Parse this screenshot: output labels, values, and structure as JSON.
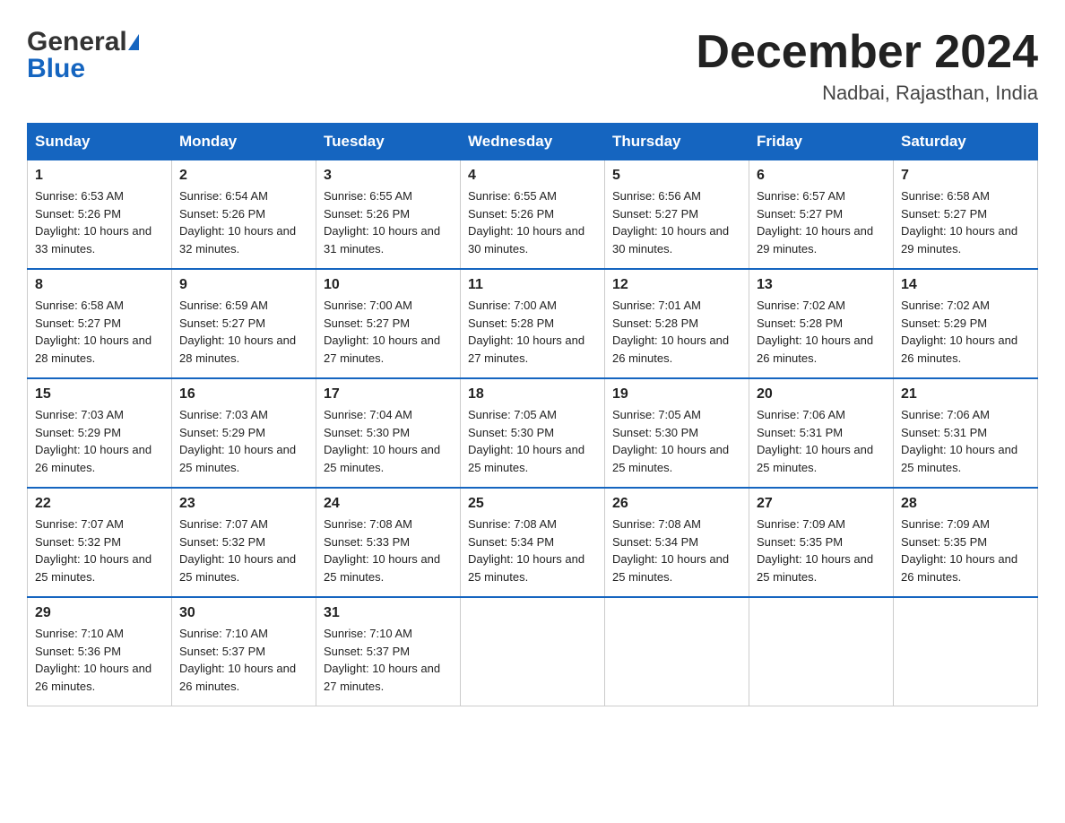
{
  "logo": {
    "general": "General",
    "blue": "Blue",
    "triangle": "▲"
  },
  "title": {
    "month_year": "December 2024",
    "location": "Nadbai, Rajasthan, India"
  },
  "headers": [
    "Sunday",
    "Monday",
    "Tuesday",
    "Wednesday",
    "Thursday",
    "Friday",
    "Saturday"
  ],
  "weeks": [
    [
      {
        "day": "1",
        "sunrise": "Sunrise: 6:53 AM",
        "sunset": "Sunset: 5:26 PM",
        "daylight": "Daylight: 10 hours and 33 minutes."
      },
      {
        "day": "2",
        "sunrise": "Sunrise: 6:54 AM",
        "sunset": "Sunset: 5:26 PM",
        "daylight": "Daylight: 10 hours and 32 minutes."
      },
      {
        "day": "3",
        "sunrise": "Sunrise: 6:55 AM",
        "sunset": "Sunset: 5:26 PM",
        "daylight": "Daylight: 10 hours and 31 minutes."
      },
      {
        "day": "4",
        "sunrise": "Sunrise: 6:55 AM",
        "sunset": "Sunset: 5:26 PM",
        "daylight": "Daylight: 10 hours and 30 minutes."
      },
      {
        "day": "5",
        "sunrise": "Sunrise: 6:56 AM",
        "sunset": "Sunset: 5:27 PM",
        "daylight": "Daylight: 10 hours and 30 minutes."
      },
      {
        "day": "6",
        "sunrise": "Sunrise: 6:57 AM",
        "sunset": "Sunset: 5:27 PM",
        "daylight": "Daylight: 10 hours and 29 minutes."
      },
      {
        "day": "7",
        "sunrise": "Sunrise: 6:58 AM",
        "sunset": "Sunset: 5:27 PM",
        "daylight": "Daylight: 10 hours and 29 minutes."
      }
    ],
    [
      {
        "day": "8",
        "sunrise": "Sunrise: 6:58 AM",
        "sunset": "Sunset: 5:27 PM",
        "daylight": "Daylight: 10 hours and 28 minutes."
      },
      {
        "day": "9",
        "sunrise": "Sunrise: 6:59 AM",
        "sunset": "Sunset: 5:27 PM",
        "daylight": "Daylight: 10 hours and 28 minutes."
      },
      {
        "day": "10",
        "sunrise": "Sunrise: 7:00 AM",
        "sunset": "Sunset: 5:27 PM",
        "daylight": "Daylight: 10 hours and 27 minutes."
      },
      {
        "day": "11",
        "sunrise": "Sunrise: 7:00 AM",
        "sunset": "Sunset: 5:28 PM",
        "daylight": "Daylight: 10 hours and 27 minutes."
      },
      {
        "day": "12",
        "sunrise": "Sunrise: 7:01 AM",
        "sunset": "Sunset: 5:28 PM",
        "daylight": "Daylight: 10 hours and 26 minutes."
      },
      {
        "day": "13",
        "sunrise": "Sunrise: 7:02 AM",
        "sunset": "Sunset: 5:28 PM",
        "daylight": "Daylight: 10 hours and 26 minutes."
      },
      {
        "day": "14",
        "sunrise": "Sunrise: 7:02 AM",
        "sunset": "Sunset: 5:29 PM",
        "daylight": "Daylight: 10 hours and 26 minutes."
      }
    ],
    [
      {
        "day": "15",
        "sunrise": "Sunrise: 7:03 AM",
        "sunset": "Sunset: 5:29 PM",
        "daylight": "Daylight: 10 hours and 26 minutes."
      },
      {
        "day": "16",
        "sunrise": "Sunrise: 7:03 AM",
        "sunset": "Sunset: 5:29 PM",
        "daylight": "Daylight: 10 hours and 25 minutes."
      },
      {
        "day": "17",
        "sunrise": "Sunrise: 7:04 AM",
        "sunset": "Sunset: 5:30 PM",
        "daylight": "Daylight: 10 hours and 25 minutes."
      },
      {
        "day": "18",
        "sunrise": "Sunrise: 7:05 AM",
        "sunset": "Sunset: 5:30 PM",
        "daylight": "Daylight: 10 hours and 25 minutes."
      },
      {
        "day": "19",
        "sunrise": "Sunrise: 7:05 AM",
        "sunset": "Sunset: 5:30 PM",
        "daylight": "Daylight: 10 hours and 25 minutes."
      },
      {
        "day": "20",
        "sunrise": "Sunrise: 7:06 AM",
        "sunset": "Sunset: 5:31 PM",
        "daylight": "Daylight: 10 hours and 25 minutes."
      },
      {
        "day": "21",
        "sunrise": "Sunrise: 7:06 AM",
        "sunset": "Sunset: 5:31 PM",
        "daylight": "Daylight: 10 hours and 25 minutes."
      }
    ],
    [
      {
        "day": "22",
        "sunrise": "Sunrise: 7:07 AM",
        "sunset": "Sunset: 5:32 PM",
        "daylight": "Daylight: 10 hours and 25 minutes."
      },
      {
        "day": "23",
        "sunrise": "Sunrise: 7:07 AM",
        "sunset": "Sunset: 5:32 PM",
        "daylight": "Daylight: 10 hours and 25 minutes."
      },
      {
        "day": "24",
        "sunrise": "Sunrise: 7:08 AM",
        "sunset": "Sunset: 5:33 PM",
        "daylight": "Daylight: 10 hours and 25 minutes."
      },
      {
        "day": "25",
        "sunrise": "Sunrise: 7:08 AM",
        "sunset": "Sunset: 5:34 PM",
        "daylight": "Daylight: 10 hours and 25 minutes."
      },
      {
        "day": "26",
        "sunrise": "Sunrise: 7:08 AM",
        "sunset": "Sunset: 5:34 PM",
        "daylight": "Daylight: 10 hours and 25 minutes."
      },
      {
        "day": "27",
        "sunrise": "Sunrise: 7:09 AM",
        "sunset": "Sunset: 5:35 PM",
        "daylight": "Daylight: 10 hours and 25 minutes."
      },
      {
        "day": "28",
        "sunrise": "Sunrise: 7:09 AM",
        "sunset": "Sunset: 5:35 PM",
        "daylight": "Daylight: 10 hours and 26 minutes."
      }
    ],
    [
      {
        "day": "29",
        "sunrise": "Sunrise: 7:10 AM",
        "sunset": "Sunset: 5:36 PM",
        "daylight": "Daylight: 10 hours and 26 minutes."
      },
      {
        "day": "30",
        "sunrise": "Sunrise: 7:10 AM",
        "sunset": "Sunset: 5:37 PM",
        "daylight": "Daylight: 10 hours and 26 minutes."
      },
      {
        "day": "31",
        "sunrise": "Sunrise: 7:10 AM",
        "sunset": "Sunset: 5:37 PM",
        "daylight": "Daylight: 10 hours and 27 minutes."
      },
      null,
      null,
      null,
      null
    ]
  ]
}
